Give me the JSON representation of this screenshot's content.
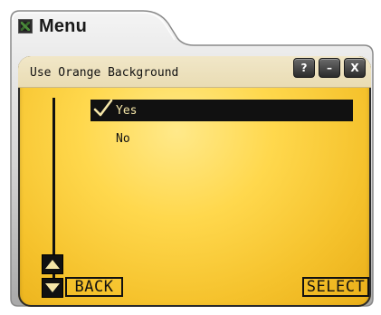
{
  "window": {
    "title": "Menu"
  },
  "screen": {
    "title": "Use Orange Background",
    "buttons": {
      "help": "?",
      "minimize": "–",
      "close": "X"
    }
  },
  "options": [
    {
      "label": "Yes",
      "selected": true
    },
    {
      "label": "No",
      "selected": false
    }
  ],
  "softkeys": {
    "back": "BACK",
    "select": "SELECT"
  },
  "colors": {
    "screen_yellow": "#ffd84d",
    "selection_bg": "#111111",
    "frame_silver": "#c8c8c8"
  }
}
